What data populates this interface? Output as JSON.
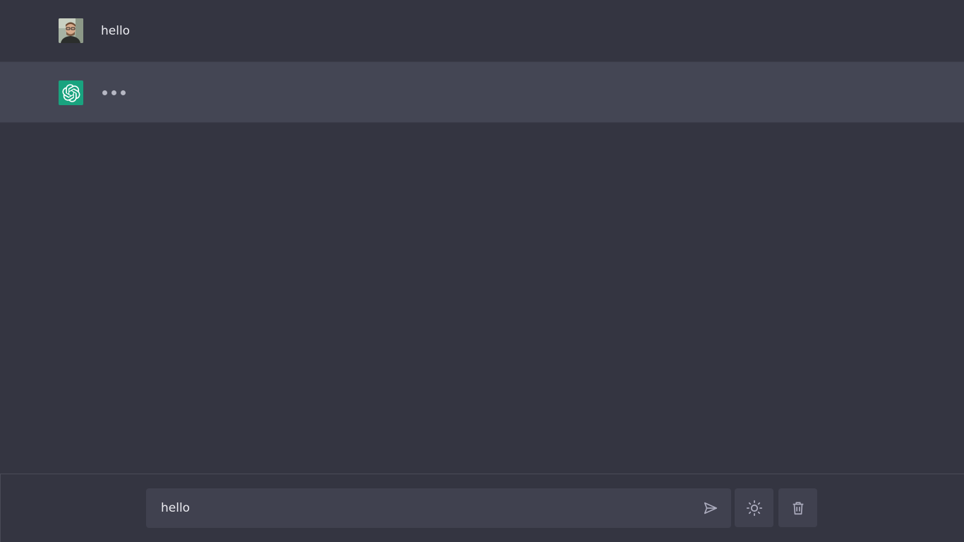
{
  "conversation": {
    "messages": [
      {
        "role": "user",
        "text": "hello",
        "avatar": "user-photo-avatar"
      },
      {
        "role": "assistant",
        "status": "typing",
        "avatar": "openai-logo-icon"
      }
    ]
  },
  "composer": {
    "input_value": "hello",
    "send_icon": "send-icon",
    "theme_icon": "sun-icon",
    "clear_icon": "trash-icon"
  },
  "colors": {
    "background": "#343541",
    "assistant_row": "#444654",
    "input_bg": "#40414f",
    "brand": "#19a37f",
    "text": "#ececf1",
    "icon": "#acacbe"
  }
}
